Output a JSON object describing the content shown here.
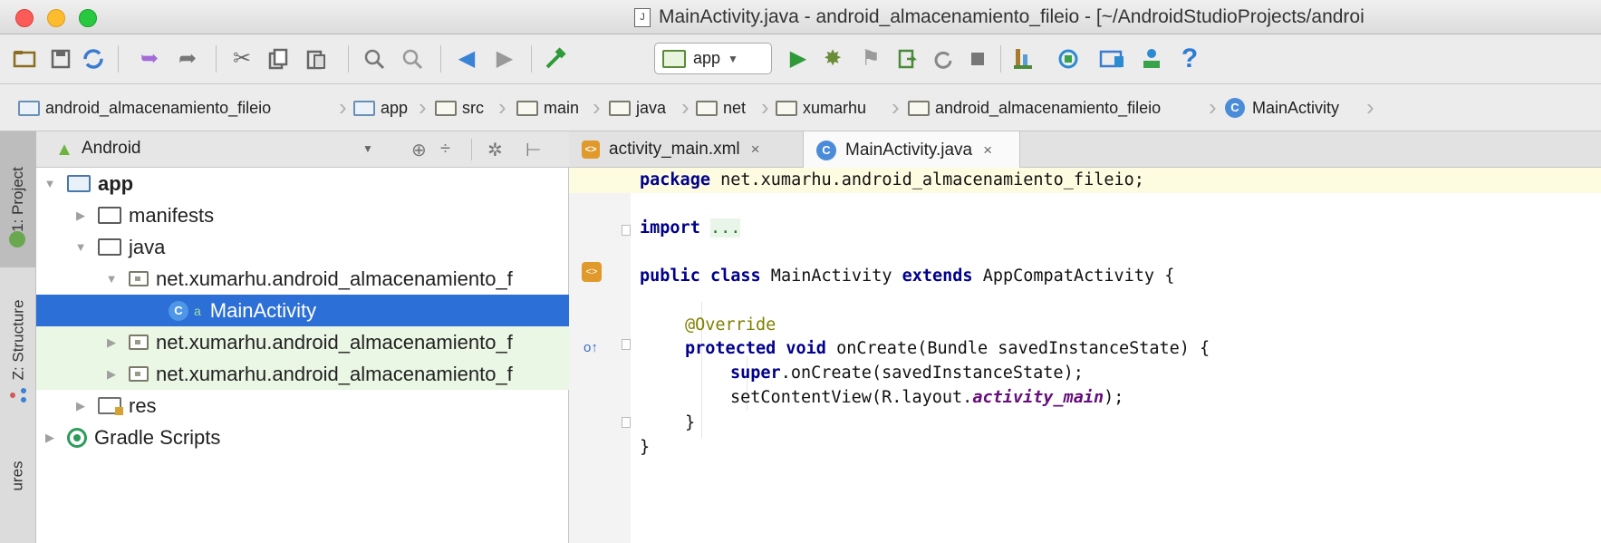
{
  "window": {
    "title": "MainActivity.java - android_almacenamiento_fileio - [~/AndroidStudioProjects/androi",
    "file_icon": "java-file-icon"
  },
  "toolbar": {
    "run_config": "app",
    "icons": [
      "open-folder-icon",
      "save-icon",
      "sync-icon",
      "undo-icon",
      "redo-icon",
      "cut-icon",
      "copy-icon",
      "paste-icon",
      "find-icon",
      "replace-icon",
      "back-icon",
      "forward-icon",
      "make-project-icon",
      "run-icon",
      "debug-icon",
      "attach-debugger-icon",
      "apply-changes-icon",
      "rerun-icon",
      "stop-icon",
      "profile-icon",
      "sdk-manager-icon",
      "avd-manager-icon",
      "project-structure-icon",
      "help-icon"
    ]
  },
  "breadcrumb": [
    {
      "label": "android_almacenamiento_fileio",
      "icon": "module-folder-icon"
    },
    {
      "label": "app",
      "icon": "module-folder-icon"
    },
    {
      "label": "src",
      "icon": "folder-icon"
    },
    {
      "label": "main",
      "icon": "folder-icon"
    },
    {
      "label": "java",
      "icon": "folder-icon"
    },
    {
      "label": "net",
      "icon": "package-icon"
    },
    {
      "label": "xumarhu",
      "icon": "package-icon"
    },
    {
      "label": "android_almacenamiento_fileio",
      "icon": "package-icon"
    },
    {
      "label": "MainActivity",
      "icon": "class-icon"
    }
  ],
  "left_stripe": {
    "project": "1: Project",
    "structure": "Z: Structure",
    "captures": "ures"
  },
  "project_panel": {
    "view_name": "Android",
    "tree": {
      "app": "app",
      "manifests": "manifests",
      "java": "java",
      "pkg_main": "net.xumarhu.android_almacenamiento_f",
      "main_activity": "MainActivity",
      "pkg_test": "net.xumarhu.android_almacenamiento_f",
      "pkg_android_test": "net.xumarhu.android_almacenamiento_f",
      "res": "res",
      "gradle": "Gradle Scripts"
    }
  },
  "editor": {
    "tabs": [
      {
        "label": "activity_main.xml",
        "active": false
      },
      {
        "label": "MainActivity.java",
        "active": true
      }
    ],
    "code": {
      "l1_kw": "package",
      "l1_rest": " net.xumarhu.android_almacenamiento_fileio;",
      "l2_kw": "import",
      "l2_dots": "...",
      "l3_kw1": "public",
      "l3_kw2": "class",
      "l3_name": " MainActivity ",
      "l3_kw3": "extends",
      "l3_rest": " AppCompatActivity {",
      "l4_ann": "@Override",
      "l5_kw1": "protected",
      "l5_kw2": "void",
      "l5_rest": " onCreate(Bundle savedInstanceState) {",
      "l6_kw": "super",
      "l6_rest": ".onCreate(savedInstanceState);",
      "l7_a": "setContentView(R.layout.",
      "l7_field": "activity_main",
      "l7_b": ");",
      "l8": "}",
      "l9": "}"
    }
  },
  "colors": {
    "selection": "#2c6fd6",
    "keyword": "#00008b",
    "annotation": "#808000",
    "field": "#660e7a",
    "highlight_line": "#fdfbe0"
  }
}
